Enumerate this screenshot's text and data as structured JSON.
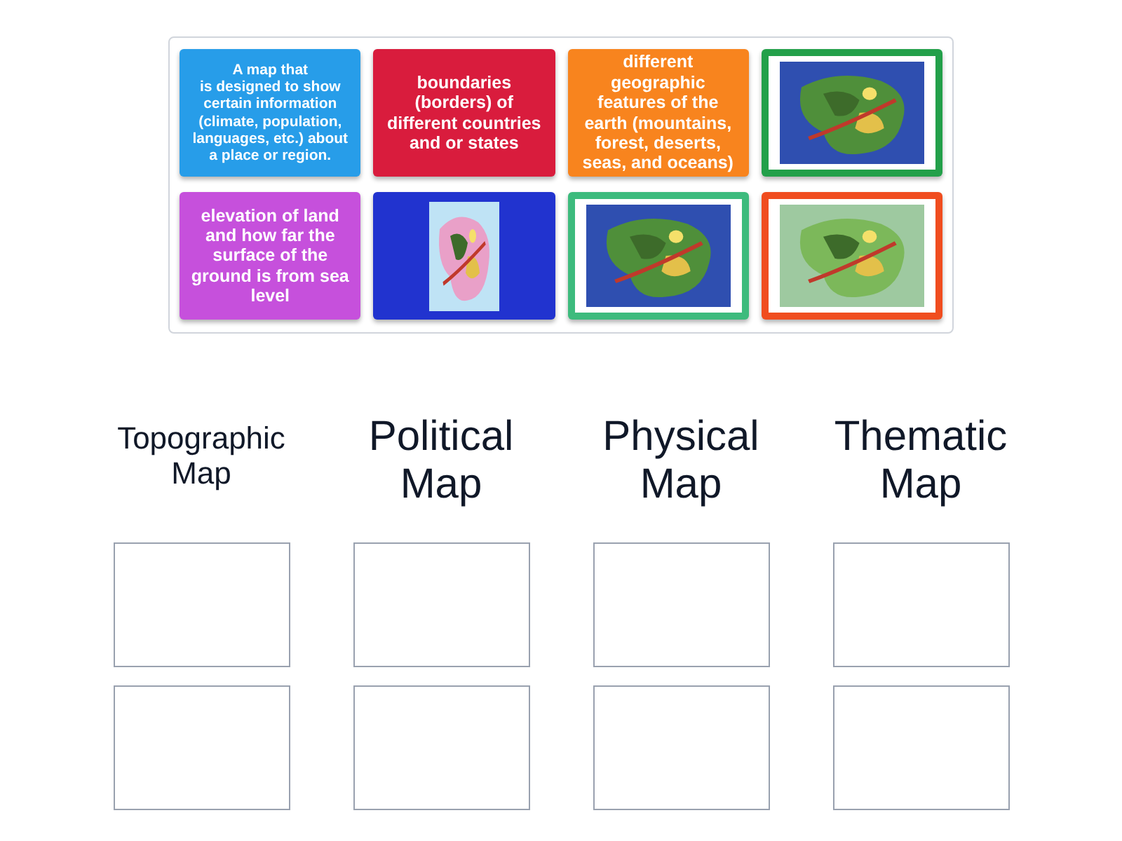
{
  "cards": [
    {
      "kind": "text",
      "color": "#279de9",
      "text": "A map that\nis designed to show certain information (climate, population, languages, etc.) about a place or region."
    },
    {
      "kind": "text",
      "color": "#d91c3d",
      "text": "boundaries (borders) of different countries and or states"
    },
    {
      "kind": "text",
      "color": "#f8841e",
      "text": "different geographic features of the earth (mountains, forest, deserts, seas, and oceans)"
    },
    {
      "kind": "picture",
      "color": "#23a04a"
    },
    {
      "kind": "text",
      "color": "#c650dc",
      "text": "elevation of land and how far the surface of the ground is from sea level"
    },
    {
      "kind": "picture",
      "color": "#2133cf"
    },
    {
      "kind": "picture",
      "color": "#3dbb7d"
    },
    {
      "kind": "picture",
      "color": "#f04d1f"
    }
  ],
  "columns": [
    {
      "title": "Topographic Map"
    },
    {
      "title": "Political Map"
    },
    {
      "title": "Physical Map"
    },
    {
      "title": "Thematic Map"
    }
  ]
}
